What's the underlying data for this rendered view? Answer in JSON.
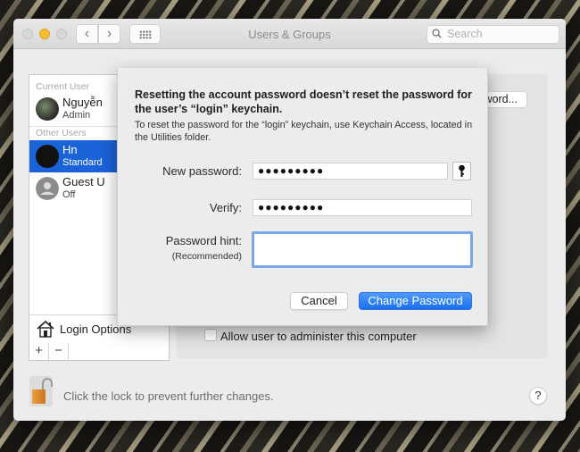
{
  "window": {
    "title": "Users & Groups",
    "search_placeholder": "Search"
  },
  "toolbar": {
    "back_glyph": "‹",
    "forward_glyph": "›"
  },
  "sidebar": {
    "current_user_header": "Current User",
    "other_users_header": "Other Users",
    "users": [
      {
        "name": "Nguyễn",
        "role": "Admin",
        "selected": false
      },
      {
        "name": "Hn",
        "role": "Standard",
        "selected": true
      },
      {
        "name": "Guest U",
        "role": "Off",
        "selected": false
      }
    ],
    "login_options_label": "Login Options",
    "add_label": "+",
    "remove_label": "−"
  },
  "content": {
    "change_password_label": "assword...",
    "admin_checkbox_label": "Allow user to administer this computer",
    "admin_checked": false
  },
  "footer": {
    "lock_text": "Click the lock to prevent further changes.",
    "help_label": "?"
  },
  "sheet": {
    "title": "Resetting the account password doesn’t reset the password for the user’s “login” keychain.",
    "description": "To reset the password for the “login” keychain, use Keychain Access, located in the Utilities folder.",
    "new_password_label": "New password:",
    "new_password_value": "●●●●●●●●●",
    "verify_label": "Verify:",
    "verify_value": "●●●●●●●●●",
    "hint_label": "Password hint:",
    "hint_sublabel": "(Recommended)",
    "hint_value": "",
    "cancel_label": "Cancel",
    "confirm_label": "Change Password"
  },
  "colors": {
    "accent": "#1a6ff0",
    "selection": "#1a62d8",
    "focus_ring": "#7aa6ea"
  }
}
